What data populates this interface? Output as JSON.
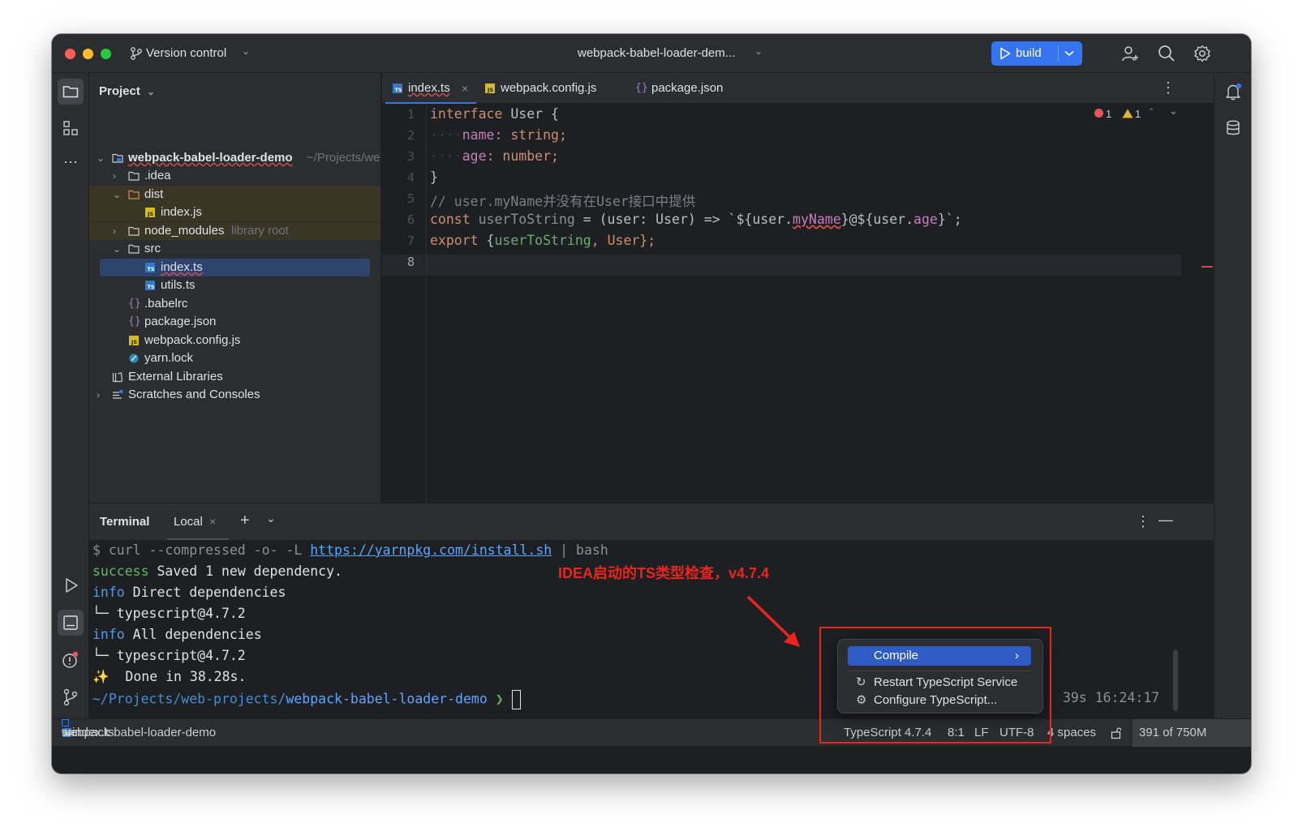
{
  "titlebar": {
    "vcs_label": "Version control",
    "project_title": "webpack-babel-loader-dem...",
    "run_config": "build"
  },
  "project_panel": {
    "title": "Project",
    "root_name": "webpack-babel-loader-demo",
    "root_path": "~/Projects/we",
    "items": [
      {
        "label": ".idea",
        "type": "folder"
      },
      {
        "label": "dist",
        "type": "folder-excluded"
      },
      {
        "label": "index.js",
        "type": "js"
      },
      {
        "label": "node_modules",
        "hint": "library root",
        "type": "folder"
      },
      {
        "label": "src",
        "type": "folder"
      },
      {
        "label": "index.ts",
        "type": "ts"
      },
      {
        "label": "utils.ts",
        "type": "ts"
      },
      {
        "label": ".babelrc",
        "type": "json"
      },
      {
        "label": "package.json",
        "type": "json"
      },
      {
        "label": "webpack.config.js",
        "type": "js"
      },
      {
        "label": "yarn.lock",
        "type": "yarn"
      },
      {
        "label": "External Libraries",
        "type": "lib"
      },
      {
        "label": "Scratches and Consoles",
        "type": "scratch"
      }
    ]
  },
  "tabs": [
    {
      "label": "index.ts",
      "active": true
    },
    {
      "label": "webpack.config.js"
    },
    {
      "label": "package.json"
    }
  ],
  "inspections": {
    "errors": "1",
    "warnings": "1"
  },
  "code": {
    "line_numbers": [
      "1",
      "2",
      "3",
      "4",
      "5",
      "6",
      "7",
      "8"
    ],
    "l1_kw": "interface",
    "l1_name": " User {",
    "l2_prop": "name",
    "l2_rest": ": string;",
    "l3_prop": "age",
    "l3_rest": ": number;",
    "l4": "}",
    "l5_comment": "// user.myName并没有在User接口中提供",
    "l6_kw": "const",
    "l6_name": " userToString",
    "l6_mid": " = (user: User) => `${user.",
    "l6_err": "myName",
    "l6_mid2": "}@${user.",
    "l6_prop": "age",
    "l6_end": "}`;",
    "l7_kw": "export",
    "l7_open": " {",
    "l7_fn": "userToString",
    "l7_end": ", User};"
  },
  "terminal": {
    "title": "Terminal",
    "tab": "Local",
    "lines": {
      "cmd_prefix": "$ curl --compressed -o- -L ",
      "cmd_url": "https://yarnpkg.com/install.sh",
      "cmd_suffix": " | bash",
      "success_tag": "success",
      "success_msg": " Saved 1 new dependency.",
      "info_tag_1": "info",
      "info_msg_1": " Direct dependencies",
      "dep_1": "└─ typescript@4.7.2",
      "info_tag_2": "info",
      "info_msg_2": " All dependencies",
      "dep_2": "└─ typescript@4.7.2",
      "done": "✨  Done in 38.28s.",
      "prompt_path_prefix": "~/Projects/web-projects/",
      "prompt_path_dir": "webpack-babel-loader-demo",
      "prompt_symbol": "❯"
    },
    "elapsed": "39s",
    "clock": "16:24:17"
  },
  "annotation": "IDEA启动的TS类型检查，v4.7.4",
  "popup": {
    "items": [
      "Compile",
      "Restart TypeScript Service",
      "Configure TypeScript..."
    ]
  },
  "statusbar": {
    "crumb_project": "webpack-babel-loader-demo",
    "crumb_src": "src",
    "crumb_file": "index.ts",
    "ts_version": "TypeScript 4.7.4",
    "position": "8:1",
    "line_sep": "LF",
    "encoding": "UTF-8",
    "indent": "4 spaces",
    "memory": "391 of 750M"
  },
  "colors": {
    "accent": "#3574f0",
    "annotation_red": "#e8261e",
    "background": "#1e1f22"
  }
}
